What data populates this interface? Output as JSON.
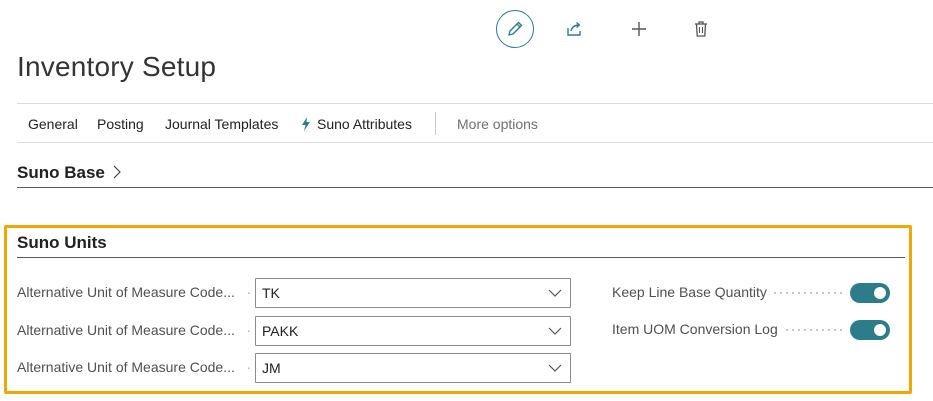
{
  "actions": {
    "edit_icon": "pencil-icon",
    "share_icon": "share-icon",
    "add_icon": "plus-icon",
    "delete_icon": "trash-icon",
    "accent_color": "#2c7d89"
  },
  "page": {
    "title": "Inventory Setup"
  },
  "menu": {
    "items": [
      {
        "label": "General"
      },
      {
        "label": "Posting"
      },
      {
        "label": "Journal Templates"
      },
      {
        "label": "Suno Attributes",
        "icon": "lightning-icon"
      }
    ],
    "more_label": "More options"
  },
  "sections": {
    "suno_base": {
      "title": "Suno Base"
    },
    "suno_units": {
      "title": "Suno Units",
      "highlight_color": "#f0a800",
      "fields": [
        {
          "label": "Alternative Unit of Measure Code...",
          "value": "TK"
        },
        {
          "label": "Alternative Unit of Measure Code...",
          "value": "PAKK"
        },
        {
          "label": "Alternative Unit of Measure Code...",
          "value": "JM"
        }
      ],
      "toggles": [
        {
          "label": "Keep Line Base Quantity",
          "on": true
        },
        {
          "label": "Item UOM Conversion Log",
          "on": true
        }
      ]
    }
  }
}
